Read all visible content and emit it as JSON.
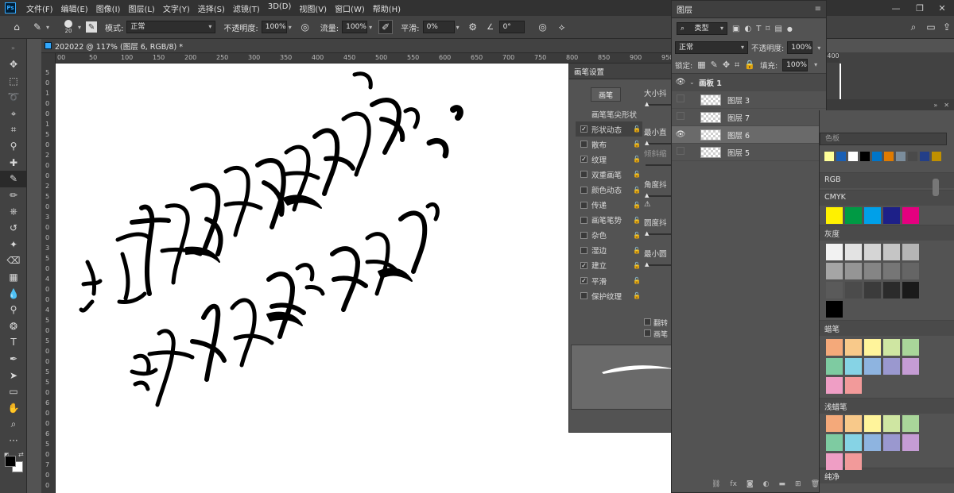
{
  "app": {
    "logo": "Ps"
  },
  "menu": [
    "文件(F)",
    "编辑(E)",
    "图像(I)",
    "图层(L)",
    "文字(Y)",
    "选择(S)",
    "滤镜(T)",
    "3D(D)",
    "视图(V)",
    "窗口(W)",
    "帮助(H)"
  ],
  "window_controls": {
    "minimize": "—",
    "restore": "❐",
    "close": "✕"
  },
  "options": {
    "brush_size": "20",
    "mode_label": "模式:",
    "mode_value": "正常",
    "opacity_label": "不透明度:",
    "opacity_value": "100%",
    "flow_label": "流量:",
    "flow_value": "100%",
    "smooth_label": "平滑:",
    "smooth_value": "0%",
    "angle_value": "0°"
  },
  "document": {
    "tab_title": "202022 @ 117% (图层 6, RGB/8) *"
  },
  "ruler": {
    "h": [
      "00",
      "50",
      "100",
      "150",
      "200",
      "250",
      "300",
      "350",
      "400",
      "450",
      "500",
      "550",
      "600",
      "650",
      "700",
      "750",
      "800",
      "850",
      "900",
      "950"
    ],
    "v": [
      "5",
      "0",
      "1",
      "0",
      "0",
      "1",
      "5",
      "0",
      "2",
      "0",
      "0",
      "2",
      "5",
      "0",
      "3",
      "0",
      "0",
      "3",
      "5",
      "0",
      "4",
      "0",
      "0",
      "4",
      "5",
      "0",
      "5",
      "0",
      "0",
      "5",
      "5",
      "0",
      "6",
      "0",
      "0",
      "6",
      "5",
      "0",
      "7",
      "0",
      "0"
    ]
  },
  "brush_settings": {
    "title": "画笔设置",
    "brushes_button": "画笔",
    "items": [
      {
        "label": "画笔笔尖形状",
        "check": false,
        "box": false,
        "lock": false
      },
      {
        "label": "形状动态",
        "check": true,
        "box": true,
        "lock": true,
        "sel": true
      },
      {
        "label": "散布",
        "check": false,
        "box": true,
        "lock": true
      },
      {
        "label": "纹理",
        "check": true,
        "box": true,
        "lock": true
      },
      {
        "label": "双重画笔",
        "check": false,
        "box": true,
        "lock": true
      },
      {
        "label": "颜色动态",
        "check": false,
        "box": true,
        "lock": true
      },
      {
        "label": "传递",
        "check": false,
        "box": true,
        "lock": true
      },
      {
        "label": "画笔笔势",
        "check": false,
        "box": true,
        "lock": true
      },
      {
        "label": "杂色",
        "check": false,
        "box": true,
        "lock": true
      },
      {
        "label": "湿边",
        "check": false,
        "box": true,
        "lock": true
      },
      {
        "label": "建立",
        "check": true,
        "box": true,
        "lock": true
      },
      {
        "label": "平滑",
        "check": true,
        "box": true,
        "lock": true
      },
      {
        "label": "保护纹理",
        "check": false,
        "box": true,
        "lock": true
      }
    ],
    "right_labels": [
      "大小抖",
      "最小直",
      "倾斜缩",
      "角度抖",
      "圆度抖",
      "最小圆"
    ],
    "flip_labels": [
      "翻转",
      "画笔"
    ]
  },
  "layers": {
    "title": "图层",
    "filter_label": "类型",
    "blend_mode": "正常",
    "opacity_label": "不透明度:",
    "opacity_value": "100%",
    "lock_label": "锁定:",
    "fill_label": "填充:",
    "fill_value": "100%",
    "artboard": "画板 1",
    "items": [
      {
        "name": "图层 3",
        "visible": false,
        "selected": false
      },
      {
        "name": "图层 7",
        "visible": false,
        "selected": false
      },
      {
        "name": "图层 6",
        "visible": true,
        "selected": true
      },
      {
        "name": "图层 5",
        "visible": false,
        "selected": false
      }
    ],
    "footer_icons": [
      "link-icon",
      "fx-icon",
      "mask-icon",
      "adjustment-icon",
      "folder-icon",
      "new-layer-icon",
      "trash-icon"
    ]
  },
  "swatches": {
    "search_placeholder": "色板",
    "groups": [
      "RGB",
      "CMYK",
      "灰度",
      "蜡笔",
      "浅蜡笔",
      "纯净"
    ],
    "colors": {
      "recent": [
        "#ffff99",
        "#1a5fb4",
        "#ffffff",
        "#000000",
        "#0075c9",
        "#e07b00",
        "#7b8d9c",
        "#4a4a4a",
        "#233f88",
        "#c09000"
      ],
      "cmyk": [
        "#fff100",
        "#009a44",
        "#00a0e9",
        "#1d2088",
        "#e4007f"
      ],
      "gray": [
        "#f2f2f2",
        "#e3e3e3",
        "#d5d5d5",
        "#c5c5c5",
        "#b5b5b5",
        "#a5a5a5",
        "#959595",
        "#858585",
        "#767676",
        "#656565",
        "#5a5a5a",
        "#4b4b4b",
        "#3b3b3b",
        "#2b2b2b",
        "#1a1a1a",
        "#000000"
      ],
      "pastel": [
        "#f4a97a",
        "#f8c98a",
        "#fff49b",
        "#cfe6a2",
        "#a9d69a",
        "#7ecba1",
        "#86d3e5",
        "#8eb4e0",
        "#9a98cf",
        "#c59cd4",
        "#ef9ec5",
        "#f29a9a"
      ],
      "light_pastel": [
        "#f4a97a",
        "#f8c98a",
        "#fff49b",
        "#cfe6a2",
        "#a9d69a",
        "#7ecba1",
        "#86d3e5",
        "#8eb4e0",
        "#9a98cf",
        "#c59cd4",
        "#ef9ec5",
        "#f29a9a"
      ]
    }
  }
}
